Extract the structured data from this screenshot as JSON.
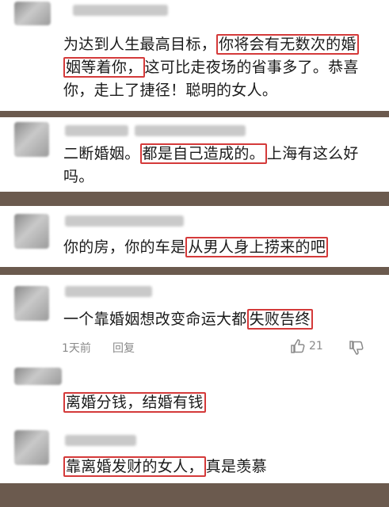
{
  "comments": [
    {
      "lines": [
        [
          {
            "t": "为达到人生最高目标，",
            "hl": false
          },
          {
            "t": "你将会有无数次的婚",
            "hl": true
          }
        ],
        [
          {
            "t": "姻等着你，",
            "hl": true
          },
          {
            "t": "这可比走夜场的省事多了。恭喜",
            "hl": false
          }
        ],
        [
          {
            "t": "你，走上了捷径！聪明的女人。",
            "hl": false
          }
        ]
      ]
    },
    {
      "lines": [
        [
          {
            "t": "二断婚姻。",
            "hl": false
          },
          {
            "t": "都是自己造成的。",
            "hl": true
          },
          {
            "t": "上海有这么好",
            "hl": false
          }
        ],
        [
          {
            "t": "吗。",
            "hl": false
          }
        ]
      ]
    },
    {
      "lines": [
        [
          {
            "t": "你的房，你的车是",
            "hl": false
          },
          {
            "t": "从男人身上捞来的吧",
            "hl": true
          }
        ]
      ]
    },
    {
      "lines": [
        [
          {
            "t": "一个靠婚姻想改变命运大都",
            "hl": false
          },
          {
            "t": "失败告终",
            "hl": true
          }
        ]
      ],
      "time": "1天前",
      "reply": "回复",
      "likes": "21"
    },
    {
      "lines": [
        [
          {
            "t": "离婚分钱，结婚有钱",
            "hl": true
          }
        ]
      ]
    },
    {
      "lines": [
        [
          {
            "t": "靠离婚发财的女人，",
            "hl": true
          },
          {
            "t": "真是羡慕",
            "hl": false
          }
        ]
      ]
    }
  ],
  "colors": {
    "highlight": "#d43a3a",
    "meta": "#8a8a8a"
  },
  "icons": {
    "like": "thumbs-up-icon",
    "dislike": "thumbs-down-icon"
  }
}
